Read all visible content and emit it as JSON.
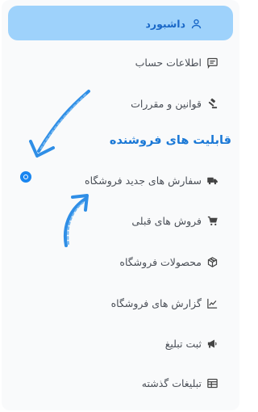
{
  "sidebar": {
    "items": [
      {
        "label": "داشبورد",
        "icon": "user-icon",
        "active": true
      },
      {
        "label": "اطلاعات حساب",
        "icon": "message-icon"
      },
      {
        "label": "قوانین و مقررات",
        "icon": "gavel-icon"
      },
      {
        "label": "سفارش های جدید فروشگاه",
        "icon": "truck-icon"
      },
      {
        "label": "فروش های قبلی",
        "icon": "cart-icon"
      },
      {
        "label": "محصولات فروشگاه",
        "icon": "box-icon"
      },
      {
        "label": "گزارش های فروشگاه",
        "icon": "chart-line-icon"
      },
      {
        "label": "ثبت تبلیغ",
        "icon": "megaphone-icon"
      },
      {
        "label": "تبلیغات گذشته",
        "icon": "table-icon"
      }
    ],
    "section_title": "قابلیت های فروشنده"
  },
  "colors": {
    "active_bg": "#9ed2fb",
    "active_text": "#1967c7",
    "section_title": "#1a78d6",
    "annotation_blue": "#1a86f0"
  }
}
